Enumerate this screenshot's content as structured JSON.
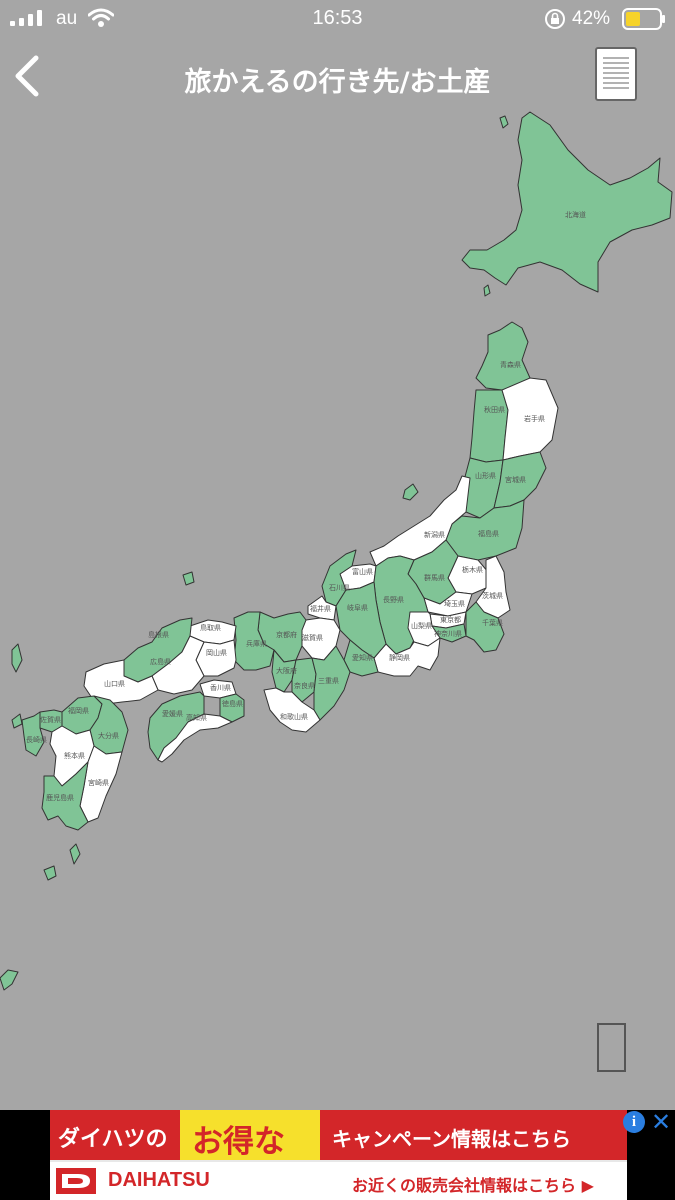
{
  "status_bar": {
    "carrier": "au",
    "time": "16:53",
    "battery_percent": "42%"
  },
  "nav": {
    "title": "旅かえるの行き先/お土産"
  },
  "map": {
    "colors": {
      "visited": "#80c496",
      "not_visited": "#ffffff",
      "border": "#333333",
      "background": "#a6a6a6"
    },
    "labels": {
      "hokkaido": "北海道",
      "aomori": "青森県",
      "akita": "秋田県",
      "iwate": "岩手県",
      "yamagata": "山形県",
      "miyagi": "宮城県",
      "niigata": "新潟県",
      "fukushima": "福島県",
      "toyama": "富山県",
      "ishikawa": "石川県",
      "nagano": "長野県",
      "gunma": "群馬県",
      "tochigi": "栃木県",
      "ibaraki": "茨城県",
      "saitama": "埼玉県",
      "chiba": "千葉県",
      "tokyo": "東京都",
      "kanagawa": "神奈川県",
      "yamanashi": "山梨県",
      "shizuoka": "静岡県",
      "gifu": "岐阜県",
      "aichi": "愛知県",
      "fukui": "福井県",
      "shiga": "滋賀県",
      "kyoto": "京都府",
      "mie": "三重県",
      "nara": "奈良県",
      "osaka": "大阪府",
      "hyogo": "兵庫県",
      "wakayama": "和歌山県",
      "tottori": "鳥取県",
      "shimane": "島根県",
      "okayama": "岡山県",
      "hiroshima": "広島県",
      "yamaguchi": "山口県",
      "kagawa": "香川県",
      "tokushima": "徳島県",
      "ehime": "愛媛県",
      "kochi": "高知県",
      "fukuoka": "福岡県",
      "saga": "佐賀県",
      "nagasaki": "長崎県",
      "oita": "大分県",
      "kumamoto": "熊本県",
      "miyazaki": "宮崎県",
      "kagoshima": "鹿児島県"
    }
  },
  "ad": {
    "headline_1": "ダイハツの",
    "headline_2": "お得な",
    "headline_3": "キャンペーン情報はこちら",
    "brand": "DAIHATSU",
    "cta": "お近くの販売会社情報はこちら ▶",
    "info_glyph": "i",
    "close_glyph": "✕"
  },
  "icons": {
    "back": "chevron-left-icon",
    "menu": "list-icon",
    "corner": "rectangle-icon"
  }
}
